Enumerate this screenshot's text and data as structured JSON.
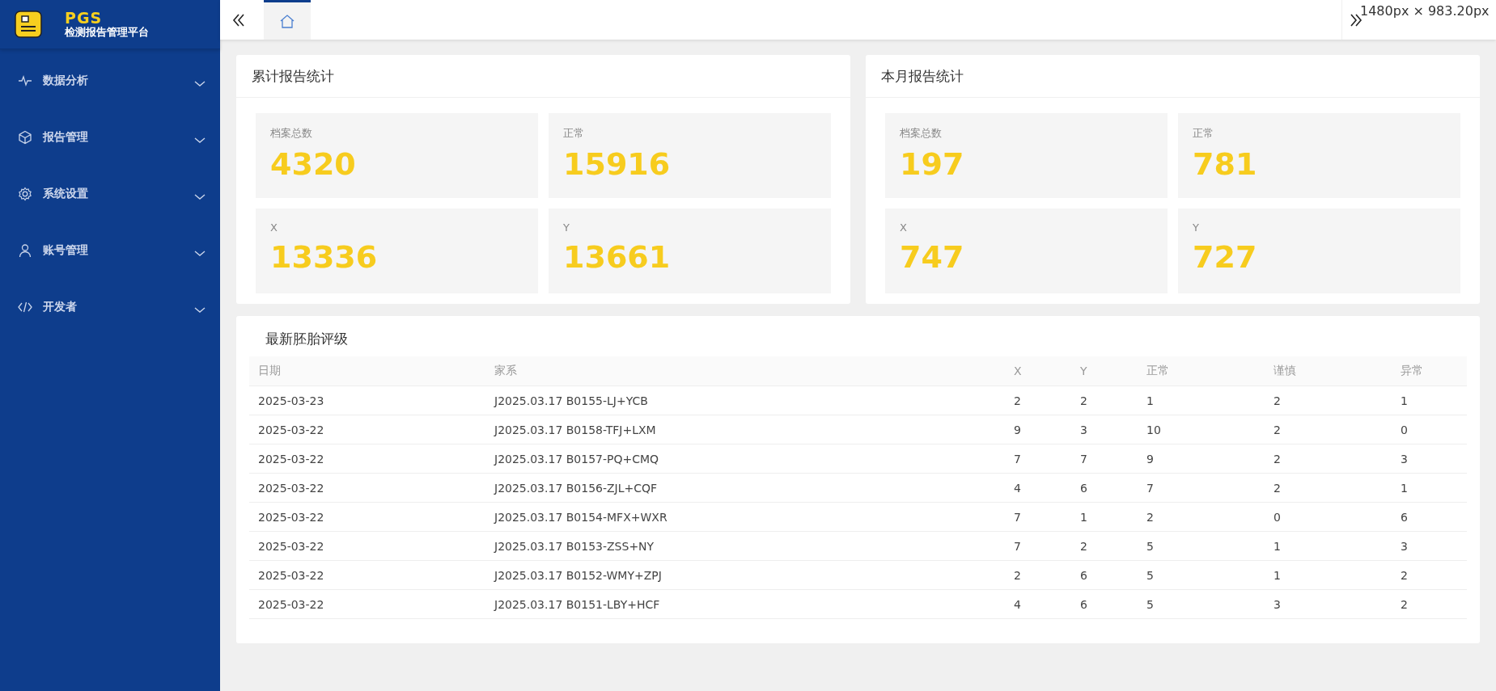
{
  "brand": {
    "title": "PGS",
    "subtitle": "检测报告管理平台"
  },
  "sidebar": {
    "items": [
      {
        "label": "数据分析",
        "expanded": false
      },
      {
        "label": "报告管理",
        "expanded": false
      },
      {
        "label": "系统设置",
        "expanded": false
      },
      {
        "label": "账号管理",
        "expanded": false
      },
      {
        "label": "开发者",
        "expanded": false
      }
    ]
  },
  "tabs": [
    {
      "selected": true
    }
  ],
  "size_tooltip": "1480px × 983.20px",
  "panels": [
    {
      "title": "累计报告统计",
      "stats": [
        {
          "label": "档案总数",
          "value": "4320"
        },
        {
          "label": "正常",
          "value": "15916"
        },
        {
          "label": "X",
          "value": "13336"
        },
        {
          "label": "Y",
          "value": "13661"
        }
      ]
    },
    {
      "title": "本月报告统计",
      "stats": [
        {
          "label": "档案总数",
          "value": "197"
        },
        {
          "label": "正常",
          "value": "781"
        },
        {
          "label": "X",
          "value": "747"
        },
        {
          "label": "Y",
          "value": "727"
        }
      ]
    }
  ],
  "table": {
    "title": "最新胚胎评级",
    "columns": [
      "日期",
      "家系",
      "X",
      "Y",
      "正常",
      "谨慎",
      "异常"
    ],
    "rows": [
      [
        "2025-03-23",
        "J2025.03.17 B0155-LJ+YCB",
        "2",
        "2",
        "1",
        "2",
        "1"
      ],
      [
        "2025-03-22",
        "J2025.03.17 B0158-TFJ+LXM",
        "9",
        "3",
        "10",
        "2",
        "0"
      ],
      [
        "2025-03-22",
        "J2025.03.17 B0157-PQ+CMQ",
        "7",
        "7",
        "9",
        "2",
        "3"
      ],
      [
        "2025-03-22",
        "J2025.03.17 B0156-ZJL+CQF",
        "4",
        "6",
        "7",
        "2",
        "1"
      ],
      [
        "2025-03-22",
        "J2025.03.17 B0154-MFX+WXR",
        "7",
        "1",
        "2",
        "0",
        "6"
      ],
      [
        "2025-03-22",
        "J2025.03.17 B0153-ZSS+NY",
        "7",
        "2",
        "5",
        "1",
        "3"
      ],
      [
        "2025-03-22",
        "J2025.03.17 B0152-WMY+ZPJ",
        "2",
        "6",
        "5",
        "1",
        "2"
      ],
      [
        "2025-03-22",
        "J2025.03.17 B0151-LBY+HCF",
        "4",
        "6",
        "5",
        "3",
        "2"
      ]
    ]
  }
}
